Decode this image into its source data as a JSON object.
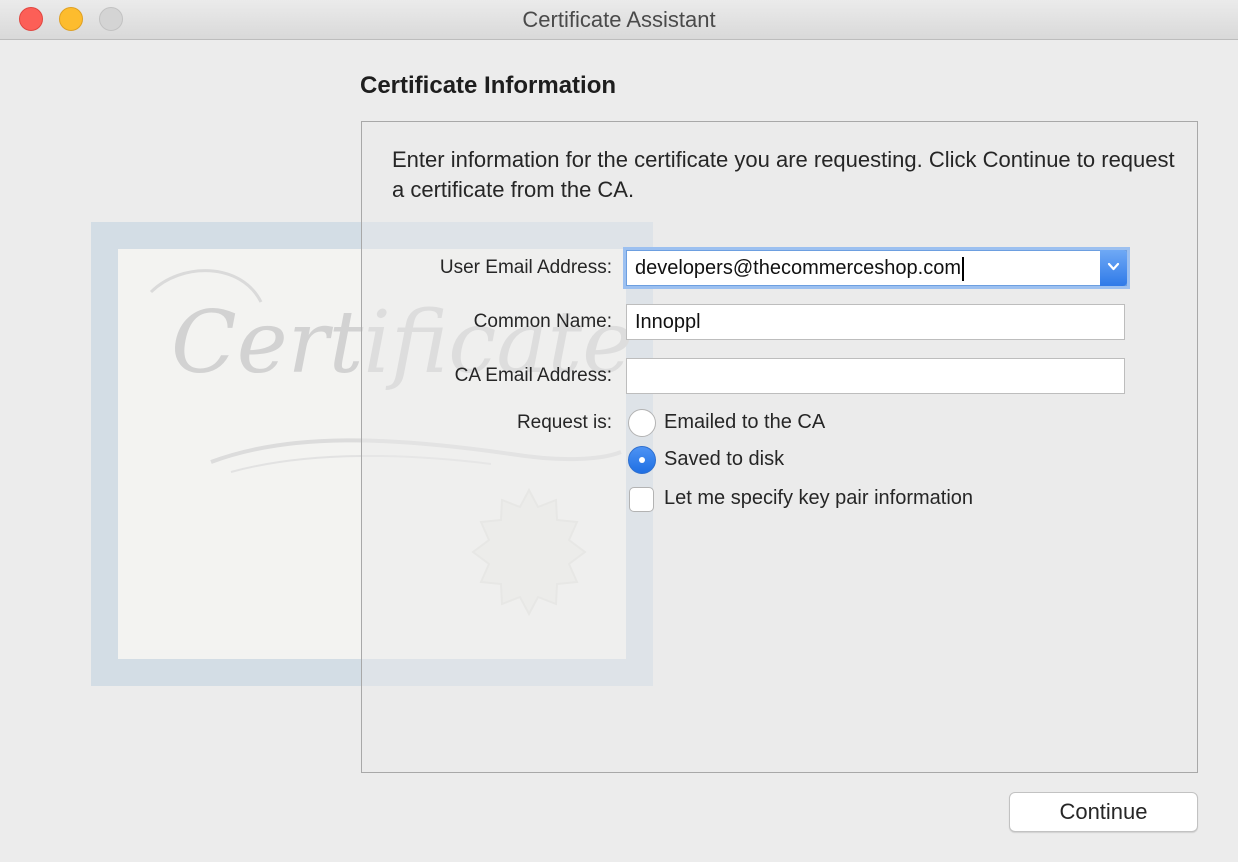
{
  "window": {
    "title": "Certificate Assistant"
  },
  "background_art": {
    "watermark_text": "Certificate"
  },
  "section": {
    "title": "Certificate Information",
    "intro": "Enter information for the certificate you are requesting. Click Continue to request a certificate from the CA."
  },
  "form": {
    "user_email": {
      "label": "User Email Address:",
      "value": "developers@thecommerceshop.com"
    },
    "common_name": {
      "label": "Common Name:",
      "value": "Innoppl"
    },
    "ca_email": {
      "label": "CA Email Address:",
      "value": ""
    },
    "request": {
      "label": "Request is:",
      "options": [
        {
          "label": "Emailed to the CA",
          "selected": false
        },
        {
          "label": "Saved to disk",
          "selected": true
        }
      ],
      "key_pair_checkbox": {
        "label": "Let me specify key pair information",
        "checked": false
      }
    }
  },
  "buttons": {
    "continue": "Continue"
  },
  "colors": {
    "accent": "#2f7ae8",
    "close": "#fc5f57",
    "minimize": "#fdbc2e"
  }
}
